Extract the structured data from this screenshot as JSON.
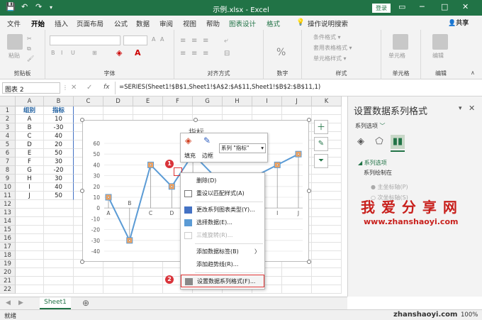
{
  "window": {
    "title": "示例.xlsx  -  Excel",
    "login_label": "登录",
    "qat": {
      "save": "💾",
      "undo": "↶",
      "redo": "↷",
      "more": "▾"
    }
  },
  "tabs": {
    "items": [
      "文件",
      "开始",
      "插入",
      "页面布局",
      "公式",
      "数据",
      "审阅",
      "视图",
      "帮助",
      "图表设计",
      "格式"
    ],
    "active": "开始",
    "search": "操作说明搜索",
    "share": "共享"
  },
  "ribbon": {
    "groups": [
      "剪贴板",
      "字体",
      "对齐方式",
      "数字",
      "样式",
      "单元格",
      "编辑"
    ],
    "paste_label": "粘贴",
    "percent_label": "%",
    "styles": [
      "条件格式 ▾",
      "套用表格格式 ▾",
      "单元格样式 ▾"
    ],
    "cells_label": "单元格",
    "edit_label": "编辑"
  },
  "formula_bar": {
    "name_box": "图表 2",
    "fx": "fx",
    "cancel": "✕",
    "confirm": "✓",
    "formula": "=SERIES(Sheet1!$B$1,Sheet1!$A$2:$A$11,Sheet1!$B$2:$B$11,1)"
  },
  "columns": [
    "A",
    "B",
    "C",
    "D",
    "E",
    "F",
    "G",
    "H",
    "I",
    "J",
    "K"
  ],
  "rows": [
    "1",
    "2",
    "3",
    "4",
    "5",
    "6",
    "7",
    "8",
    "9",
    "10",
    "11",
    "12",
    "13",
    "14",
    "15",
    "16",
    "17",
    "18",
    "19",
    "20",
    "21",
    "22"
  ],
  "table": {
    "headers": [
      "组别",
      "指标"
    ],
    "rows": [
      [
        "A",
        "10"
      ],
      [
        "B",
        "-30"
      ],
      [
        "C",
        "40"
      ],
      [
        "D",
        "20"
      ],
      [
        "E",
        "50"
      ],
      [
        "F",
        "30"
      ],
      [
        "G",
        "-20"
      ],
      [
        "H",
        "30"
      ],
      [
        "I",
        "40"
      ],
      [
        "J",
        "50"
      ]
    ]
  },
  "chart_data": {
    "type": "line",
    "title": "指标",
    "categories": [
      "A",
      "B",
      "C",
      "D",
      "E",
      "F",
      "G",
      "H",
      "I",
      "J"
    ],
    "series": [
      {
        "name": "指标",
        "values": [
          10,
          -30,
          40,
          20,
          50,
          30,
          -20,
          30,
          40,
          50
        ]
      }
    ],
    "ylim": [
      -40,
      60
    ],
    "yticks": [
      60,
      50,
      40,
      30,
      20,
      10,
      0,
      -10,
      -20,
      -30,
      -40
    ],
    "line_color": "#5b9bd5",
    "marker_color": "#f4a460",
    "drop_lines": true
  },
  "mini_toolbar": {
    "fill_label": "填充",
    "border_label": "边框",
    "series_select": "系列 \"指标\""
  },
  "context_menu": {
    "items": [
      {
        "label": "删除(D)",
        "enabled": true
      },
      {
        "label": "重设以匹配样式(A)",
        "enabled": true
      },
      {
        "label": "更改系列图表类型(Y)...",
        "enabled": true
      },
      {
        "label": "选择数据(E)...",
        "enabled": true
      },
      {
        "label": "三维旋转(R)...",
        "enabled": false
      },
      {
        "label": "添加数据标签(B)",
        "enabled": true
      },
      {
        "label": "添加趋势线(R)...",
        "enabled": true
      },
      {
        "label": "设置数据系列格式(F)...",
        "enabled": true
      }
    ],
    "submenu_arrow": "〉"
  },
  "badges": {
    "one": "1",
    "two": "2"
  },
  "panel": {
    "title": "设置数据系列格式",
    "close": "✕",
    "options_label": "系列选项",
    "dropdown_icon": "﹀",
    "section": "系列选项",
    "plot_on": "系列绘制在",
    "primary": "主坐标轴(P)",
    "secondary": "次坐标轴(S)"
  },
  "watermark": {
    "cn": "我 爱 分 享 网",
    "url": "www.zhanshaoyi.com",
    "url2": "zhanshaoyi.com"
  },
  "sheet_tab": "Sheet1",
  "add_sheet": "⊕",
  "status": {
    "ready": "就绪",
    "zoom": "100%"
  }
}
